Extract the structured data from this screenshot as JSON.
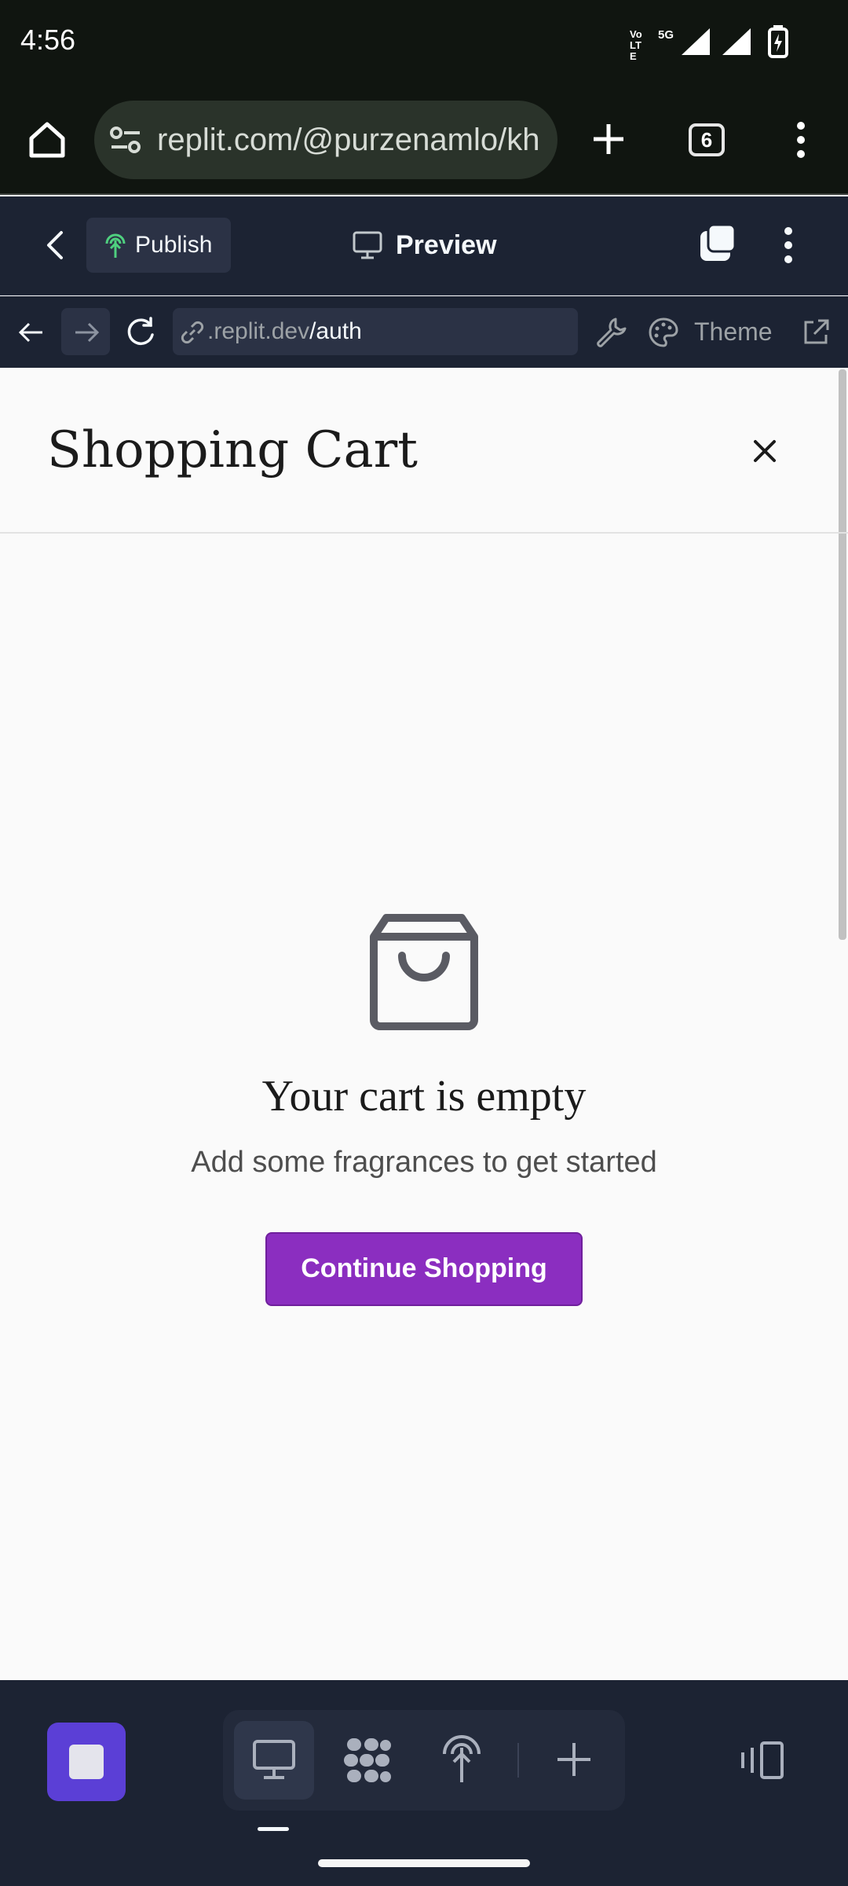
{
  "status_bar": {
    "time": "4:56",
    "network_label_1": "Vo LTE",
    "network_label_2": "5G"
  },
  "browser": {
    "url": "replit.com/@purzenamlo/kh",
    "tab_count": "6"
  },
  "replit_header": {
    "publish_label": "Publish",
    "preview_label": "Preview"
  },
  "webview": {
    "address_host": ".replit.dev",
    "address_path": "/auth",
    "theme_label": "Theme"
  },
  "cart": {
    "title": "Shopping Cart",
    "empty_title": "Your cart is empty",
    "empty_subtitle": "Add some fragrances to get started",
    "cta_label": "Continue Shopping"
  },
  "colors": {
    "accent_purple": "#8b2ec0",
    "stop_button": "#5b3fd6",
    "replit_bg": "#1c2333"
  }
}
